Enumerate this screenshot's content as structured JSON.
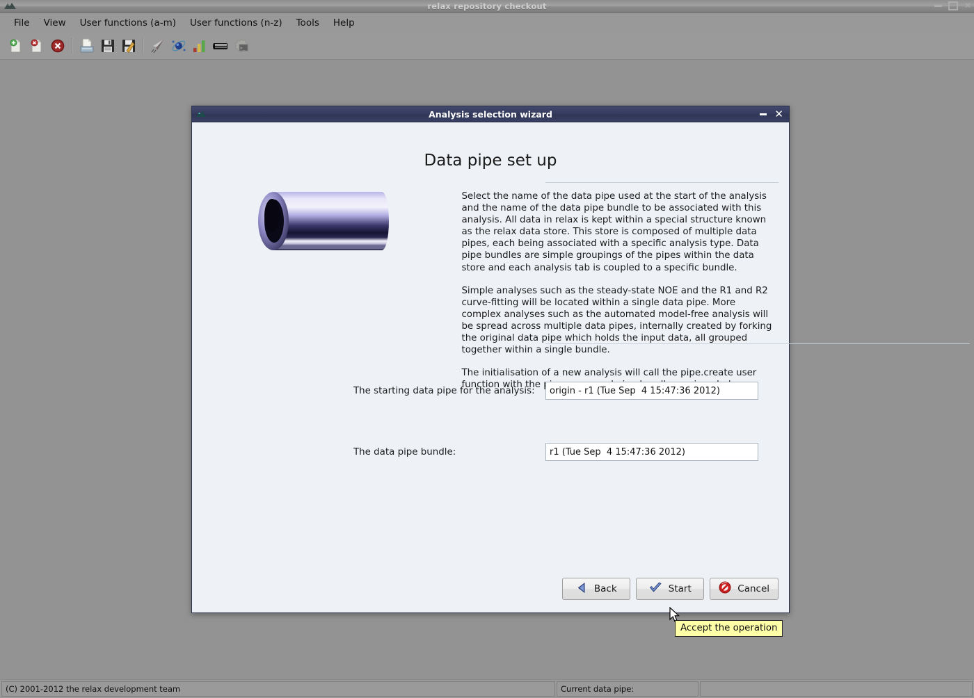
{
  "window": {
    "title": "relax repository checkout",
    "icon": "relax-mountain-icon",
    "controls": {
      "minimize": "–",
      "maximize": "❐",
      "close": "✕"
    }
  },
  "menubar": {
    "items": [
      {
        "label": "File",
        "name": "menu-file"
      },
      {
        "label": "View",
        "name": "menu-view"
      },
      {
        "label": "User functions (a-m)",
        "name": "menu-user-functions-a-m"
      },
      {
        "label": "User functions (n-z)",
        "name": "menu-user-functions-n-z"
      },
      {
        "label": "Tools",
        "name": "menu-tools"
      },
      {
        "label": "Help",
        "name": "menu-help"
      }
    ]
  },
  "toolbar": {
    "icons": [
      "new-analysis-icon",
      "close-analysis-icon",
      "close-all-analyses-icon",
      "open-state-icon",
      "save-state-icon",
      "save-state-as-icon",
      "run-script-icon",
      "spin-viewer-icon",
      "results-viewer-icon",
      "data-pipe-editor-icon",
      "prompt-console-icon"
    ]
  },
  "dialog": {
    "title": "Analysis selection wizard",
    "icon": "relax-mountain-icon",
    "minimize_label": "–",
    "close_label": "✕",
    "heading": "Data pipe set up",
    "graphic": "data-pipe-cylinder-image",
    "paragraphs": [
      "Select the name of the data pipe used at the start of the analysis and the name of the data pipe bundle to be associated with this analysis.  All data in relax is kept within a special structure known as the relax data store.  This store is composed of multiple data pipes, each being associated with a specific analysis type.  Data pipe bundles are simple groupings of the pipes within the data store and each analysis tab is coupled to a specific bundle.",
      "Simple analyses such as the steady-state NOE and the R1 and R2 curve-fitting will be located within a single data pipe.  More complex analyses such as the automated model-free analysis will be spread across multiple data pipes, internally created by forking the original data pipe which holds the input data, all grouped together within a single bundle.",
      "The initialisation of a new analysis will call the pipe.create user function with the pipe name and pipe bundle as given below."
    ],
    "fields": [
      {
        "label": "The starting data pipe for the analysis:",
        "value": "origin - r1 (Tue Sep  4 15:47:36 2012)",
        "placeholder": "",
        "name": "starting-data-pipe-input"
      },
      {
        "label": "The data pipe bundle:",
        "value": "r1 (Tue Sep  4 15:47:36 2012)",
        "placeholder": "",
        "name": "data-pipe-bundle-input"
      }
    ],
    "buttons": [
      {
        "label": "Back",
        "icon": "back-triangle-icon",
        "name": "back-button"
      },
      {
        "label": "Start",
        "icon": "checkmark-icon",
        "name": "start-button"
      },
      {
        "label": "Cancel",
        "icon": "cancel-prohibition-icon",
        "name": "cancel-button"
      }
    ],
    "tooltip": "Accept the operation"
  },
  "statusbar": {
    "copyright": "(C) 2001-2012 the relax development team",
    "current_pipe_label": "Current data pipe:",
    "current_pipe_value": ""
  },
  "colors": {
    "desktop": "#939393",
    "dialog_bg": "#eef1f6",
    "dialog_titlebar": "#363c5e",
    "tooltip_bg": "#ffffa8",
    "accent_blue": "#4f6db5",
    "cancel_red": "#cc1f1f"
  }
}
